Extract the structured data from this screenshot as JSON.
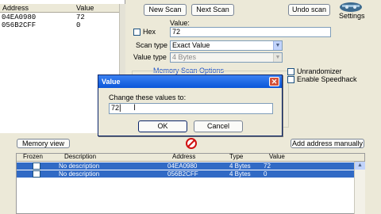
{
  "results": {
    "headers": {
      "address": "Address",
      "value": "Value"
    },
    "rows": [
      {
        "address": "04EA0980",
        "value": "72"
      },
      {
        "address": "056B2CFF",
        "value": "0"
      }
    ]
  },
  "toolbar": {
    "new_scan": "New Scan",
    "next_scan": "Next Scan",
    "undo_scan": "Undo scan",
    "settings": "Settings"
  },
  "scan": {
    "value_label": "Value:",
    "hex_label": "Hex",
    "value_input": "72",
    "scan_type_label": "Scan type",
    "scan_type_value": "Exact Value",
    "value_type_label": "Value type",
    "value_type_value": "4 Bytes",
    "memory_options": "Memory Scan Options",
    "unrandomizer": "Unrandomizer",
    "speedhack": "Enable Speedhack"
  },
  "dialog": {
    "title": "Value",
    "prompt": "Change these values to:",
    "input_value": "72",
    "ok": "OK",
    "cancel": "Cancel"
  },
  "bottom": {
    "memory_view": "Memory view",
    "add_address": "Add address manually"
  },
  "address_list": {
    "headers": {
      "frozen": "Frozen",
      "description": "Description",
      "address": "Address",
      "type": "Type",
      "value": "Value"
    },
    "rows": [
      {
        "description": "No description",
        "address": "04EA0980",
        "type": "4 Bytes",
        "value": "72"
      },
      {
        "description": "No description",
        "address": "056B2CFF",
        "type": "4 Bytes",
        "value": "0"
      }
    ]
  },
  "colors": {
    "selection": "#316ac5",
    "title_bar": "#0b56d8",
    "window_bg": "#ece9d8"
  }
}
